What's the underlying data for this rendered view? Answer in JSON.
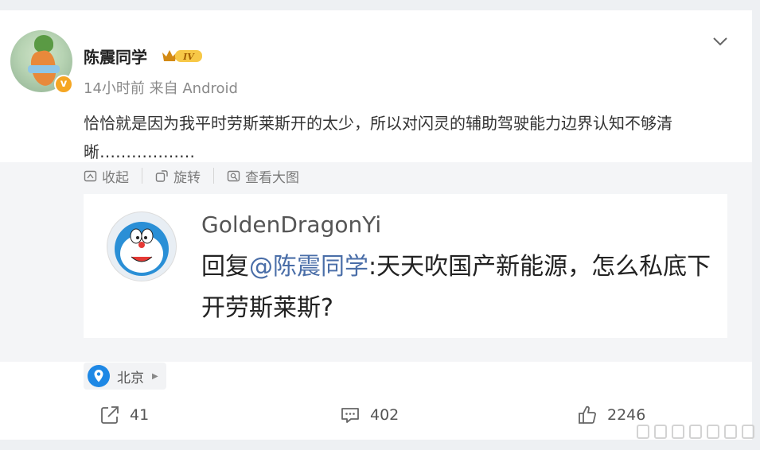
{
  "post": {
    "username": "陈震同学",
    "level_badge": "IV",
    "time": "14小时前",
    "source": "来自 Android",
    "text": "恰恰就是因为我平时劳斯莱斯开的太少，所以对闪灵的辅助驾驶能力边界认知不够清晰………………"
  },
  "media_tools": {
    "collapse": "收起",
    "rotate": "旋转",
    "view_large": "查看大图"
  },
  "image_content": {
    "reply_user": "GoldenDragonYi",
    "reply_prefix": "回复",
    "reply_mention": "@陈震同学",
    "reply_text": ":天天吹国产新能源，怎么私底下开劳斯莱斯?"
  },
  "location": "北京",
  "actions": {
    "repost_count": "41",
    "comment_count": "402",
    "like_count": "2246"
  },
  "colors": {
    "background": "#eef0f3",
    "card": "#ffffff",
    "media_bg": "#f4f5f7",
    "mention": "#4a6ea8",
    "badge": "#f5a623",
    "location_pin": "#1e88e5"
  },
  "icons": [
    "chevron-down-icon",
    "collapse-icon",
    "rotate-icon",
    "view-large-icon",
    "location-pin-icon",
    "repost-icon",
    "comment-icon",
    "like-icon"
  ]
}
